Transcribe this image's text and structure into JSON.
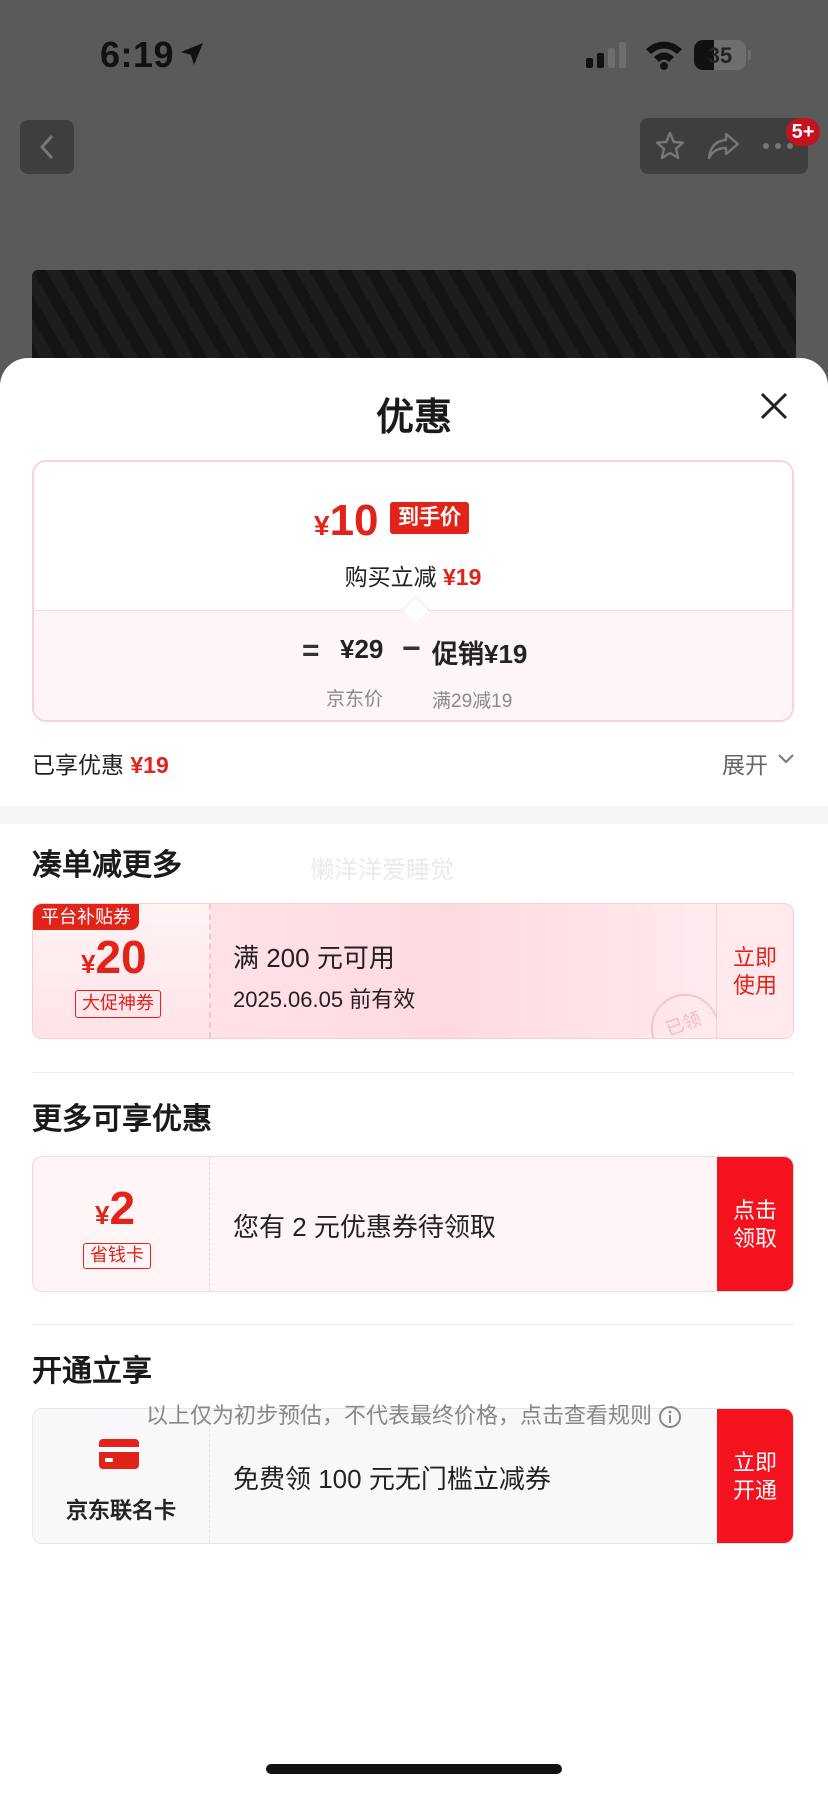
{
  "status_bar": {
    "time": "6:19",
    "battery": "35"
  },
  "header": {
    "notification_count": "5+"
  },
  "sheet": {
    "title": "优惠",
    "price_summary": {
      "final_price_symbol": "¥",
      "final_price": "10",
      "final_price_tag": "到手价",
      "reduce_text": "购买立减",
      "reduce_amount": "¥19",
      "equals": "=",
      "jd_price": "¥29",
      "jd_price_label": "京东价",
      "minus": "−",
      "promo_price": "促销¥19",
      "promo_label": "满29减19"
    },
    "enjoyed": {
      "label": "已享优惠",
      "amount": "¥19"
    },
    "expand_label": "展开",
    "watermark": "懒洋洋爱睡觉",
    "sections": {
      "combine": {
        "title": "凑单减更多",
        "coupon": {
          "tag": "平台补贴券",
          "symbol": "¥",
          "amount": "20",
          "subtitle": "大促神券",
          "condition": "满 200 元可用",
          "validity": "2025.06.05 前有效",
          "action_line1": "立即",
          "action_line2": "使用",
          "stamp": "已领"
        }
      },
      "more": {
        "title": "更多可享优惠",
        "coupon": {
          "symbol": "¥",
          "amount": "2",
          "subtitle": "省钱卡",
          "text": "您有 2 元优惠券待领取",
          "action_line1": "点击",
          "action_line2": "领取"
        }
      },
      "open": {
        "title": "开通立享",
        "coupon": {
          "card_name": "京东联名卡",
          "text": "免费领 100 元无门槛立减券",
          "action_line1": "立即",
          "action_line2": "开通"
        }
      }
    },
    "disclaimer": "以上仅为初步预估，不代表最终价格，点击查看规则"
  },
  "colors": {
    "accent": "#e2231a",
    "muted": "#888888"
  }
}
